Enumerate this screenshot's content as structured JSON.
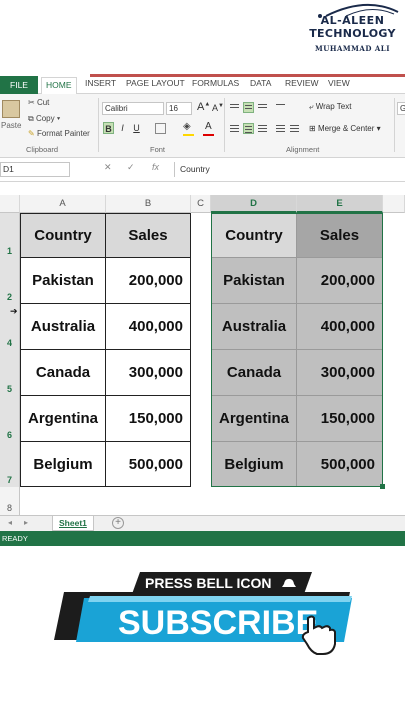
{
  "logo": {
    "line1": "AL-ALEEN",
    "line2": "TECHNOLOGY",
    "line3": "MUHAMMAD ALI"
  },
  "ribbon_tabs": [
    "FILE",
    "HOME",
    "INSERT",
    "PAGE LAYOUT",
    "FORMULAS",
    "DATA",
    "REVIEW",
    "VIEW"
  ],
  "clipboard": {
    "paste": "Paste",
    "cut": "Cut",
    "copy": "Copy",
    "format_painter": "Format Painter",
    "group_label": "Clipboard"
  },
  "font": {
    "name": "Calibri",
    "size": "16",
    "grow": "A",
    "shrink": "A",
    "bold": "B",
    "italic": "I",
    "underline": "U",
    "group_label": "Font"
  },
  "alignment": {
    "wrap_text": "Wrap Text",
    "merge_center": "Merge & Center",
    "group_label": "Alignment",
    "number_format_partial": "G"
  },
  "formula_bar": {
    "name_box": "D1",
    "fx": "fx",
    "content": "Country"
  },
  "columns": [
    "A",
    "B",
    "C",
    "D",
    "E"
  ],
  "rows": [
    "1",
    "2",
    "4",
    "5",
    "6",
    "7",
    "8"
  ],
  "table_left": {
    "headers": [
      "Country",
      "Sales"
    ],
    "rows": [
      [
        "Pakistan",
        "200,000"
      ],
      [
        "Australia",
        "400,000"
      ],
      [
        "Canada",
        "300,000"
      ],
      [
        "Argentina",
        "150,000"
      ],
      [
        "Belgium",
        "500,000"
      ]
    ]
  },
  "table_right": {
    "headers": [
      "Country",
      "Sales"
    ],
    "rows": [
      [
        "Pakistan",
        "200,000"
      ],
      [
        "Australia",
        "400,000"
      ],
      [
        "Canada",
        "300,000"
      ],
      [
        "Argentina",
        "150,000"
      ],
      [
        "Belgium",
        "500,000"
      ]
    ]
  },
  "sheets": {
    "active": "Sheet1",
    "add": "+"
  },
  "status": "READY",
  "banner": {
    "top_text": "PRESS BELL ICON",
    "main_text": "SUBSCRIBE"
  },
  "colors": {
    "excel_green": "#217346",
    "banner_blue": "#1aa3d6",
    "banner_dark": "#1c1c1c"
  }
}
